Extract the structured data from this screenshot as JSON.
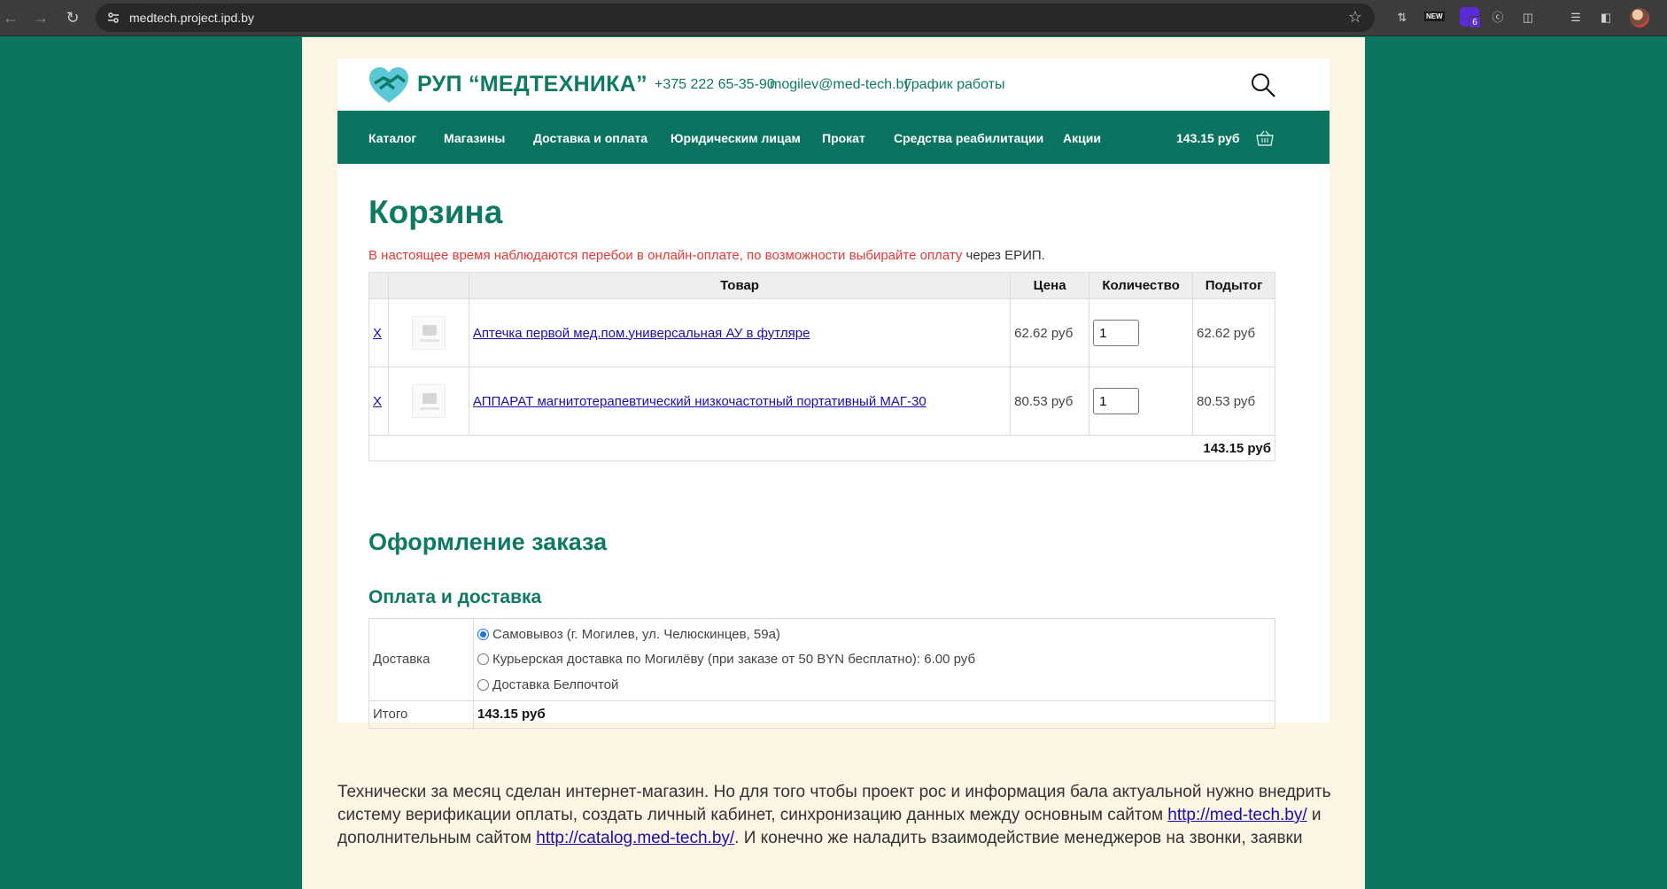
{
  "browser": {
    "url": "medtech.project.ipd.by",
    "ext_new_label": "NEW",
    "ext_badge_count": "6"
  },
  "header": {
    "logo_text": "РУП “МЕДТЕХНИКА”",
    "phone": "+375 222 65-35-90",
    "email": "mogilev@med-tech.by",
    "schedule": "График работы"
  },
  "nav": {
    "items": [
      "Каталог",
      "Магазины",
      "Доставка и оплата",
      "Юридическим лицам",
      "Прокат",
      "Средства реабилитации",
      "Акции"
    ],
    "cart_total": "143.15 руб"
  },
  "cart": {
    "title": "Корзина",
    "notice_red": "В настоящее время наблюдаются перебои в онлайн-оплате, по возможности выбирайте оплату",
    "notice_tail": " через ЕРИП.",
    "columns": [
      "",
      "",
      "Товар",
      "Цена",
      "Количество",
      "Подытог"
    ],
    "rows": [
      {
        "remove": "X",
        "name": "Аптечка первой мед.пом.универсальная АУ в футляре",
        "price": "62.62 руб",
        "qty": "1",
        "subtotal": "62.62 руб"
      },
      {
        "remove": "X",
        "name": "АППАРАТ магнитотерапевтический низкочастотный портативный МАГ-30",
        "price": "80.53 руб",
        "qty": "1",
        "subtotal": "80.53 руб"
      }
    ],
    "total": "143.15 руб"
  },
  "order": {
    "title": "Оформление заказа",
    "subtitle": "Оплата и доставка",
    "delivery_label": "Доставка",
    "options": [
      {
        "label": "Самовывоз (г. Могилев, ул. Челюскинцев, 59а)",
        "selected": true
      },
      {
        "label": "Курьерская доставка по Могилёву (при заказе от 50 BYN бесплатно): 6.00 руб",
        "selected": false
      },
      {
        "label": "Доставка Белпочтой",
        "selected": false
      }
    ],
    "total_label": "Итого",
    "total_value": "143.15 руб"
  },
  "footer": {
    "text_1": "Технически за месяц сделан интернет-магазин. Но для того чтобы проект рос и информация бала актуальной нужно внедрить систему верификации оплаты, создать личный кабинет, синхронизацию данных между основным сайтом ",
    "link_1": "http://med-tech.by/",
    "text_2": " и дополнительным сайтом ",
    "link_2": "http://catalog.med-tech.by/",
    "text_3": ". И конечно же наладить взаимодействие менеджеров на звонки, заявки"
  },
  "colors": {
    "brand_green": "#0a7461",
    "page_bg": "#0b7560",
    "outer_bg": "#fcf5e3",
    "notice_red": "#e53935",
    "link_blue": "#1a0dab"
  }
}
